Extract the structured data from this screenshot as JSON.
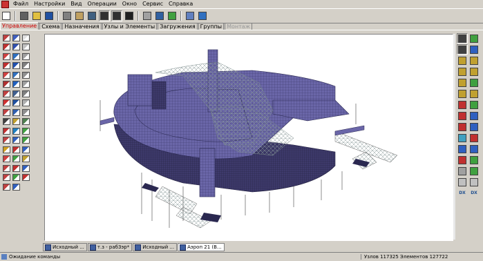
{
  "menu": {
    "items": [
      "Файл",
      "Настройки",
      "Вид",
      "Операции",
      "Окно",
      "Сервис",
      "Справка"
    ]
  },
  "toolbar": {
    "buttons": [
      {
        "icon": "new-file-icon",
        "color": "#ffffff"
      },
      {
        "icon": "print-icon",
        "color": "#606060"
      },
      {
        "icon": "open-folder-icon",
        "color": "#e0c040"
      },
      {
        "icon": "save-icon",
        "color": "#2050a0"
      },
      {
        "icon": "table-icon",
        "color": "#808080"
      },
      {
        "icon": "clipboard-icon",
        "color": "#c0a060"
      },
      {
        "icon": "filter-icon",
        "color": "#406080"
      },
      {
        "icon": "model-view-icon",
        "color": "#303030",
        "pressed": true
      },
      {
        "icon": "model-view-2-icon",
        "color": "#303030",
        "pressed": true
      },
      {
        "icon": "display-icon",
        "color": "#202020"
      },
      {
        "icon": "spring-icon",
        "color": "#a0a0a0"
      },
      {
        "icon": "calculator-icon",
        "color": "#3060a0"
      },
      {
        "icon": "results-icon",
        "color": "#40a040"
      },
      {
        "icon": "window-icon",
        "color": "#6080c0"
      },
      {
        "icon": "help-icon",
        "color": "#3070c0"
      }
    ]
  },
  "tabs": [
    {
      "label": "Управление",
      "state": "active"
    },
    {
      "label": "Схема",
      "state": "normal"
    },
    {
      "label": "Назначения",
      "state": "normal"
    },
    {
      "label": "Узлы и Элементы",
      "state": "normal"
    },
    {
      "label": "Загружения",
      "state": "normal"
    },
    {
      "label": "Группы",
      "state": "normal"
    },
    {
      "label": "Монтаж",
      "state": "disabled"
    }
  ],
  "left_panel": {
    "button_colors": [
      "#c04040",
      "#4060c0",
      "#e0e0e0",
      "#c03030",
      "#3050b0",
      "#c0c0c0",
      "#d04040",
      "#3070c0",
      "#a0a0a0",
      "#c03030",
      "#2050b0",
      "#808080",
      "#d04040",
      "#3070c0",
      "#909090",
      "#b03030",
      "#2060c0",
      "#a0a0a0",
      "#c04040",
      "#406090",
      "#808080",
      "#d03030",
      "#2050a0",
      "#b0b0b0",
      "#c04040",
      "#3060b0",
      "#909090",
      "#404040",
      "#c0a030",
      "#508050",
      "#c03030",
      "#2080c0",
      "#40a040",
      "#c04040",
      "#3060c0",
      "#40a040",
      "#d0a020",
      "#c03030",
      "#3060c0",
      "#d04040",
      "#40a040",
      "#c0a030",
      "#c04040",
      "#c03030",
      "#3060c0",
      "#c04040",
      "#40a040",
      "#c03030",
      "#c04040",
      "#3060c0"
    ]
  },
  "right_panel": {
    "buttons": [
      {
        "icon": "rotate-icon",
        "color": "#404040",
        "pressed": true
      },
      {
        "icon": "rotate-axis-icon",
        "color": "#40a040"
      },
      {
        "icon": "eye-icon",
        "color": "#404040",
        "pressed": true
      },
      {
        "icon": "pan-icon",
        "color": "#3060c0"
      },
      {
        "icon": "view-front-icon",
        "color": "#c0a030"
      },
      {
        "icon": "view-top-icon",
        "color": "#c0a030"
      },
      {
        "icon": "view-side-icon",
        "color": "#c0a030"
      },
      {
        "icon": "view-iso-icon",
        "color": "#c0a030"
      },
      {
        "icon": "view-xz-icon",
        "color": "#c0a030"
      },
      {
        "icon": "view-yz-icon",
        "color": "#40a040"
      },
      {
        "icon": "projection-icon",
        "color": "#c0a030"
      },
      {
        "icon": "perspective-icon",
        "color": "#c0a030"
      },
      {
        "icon": "fragment-icon",
        "color": "#c03030"
      },
      {
        "icon": "fragment-2-icon",
        "color": "#40a040"
      },
      {
        "icon": "cube-icon",
        "color": "#c03030"
      },
      {
        "icon": "cube-2-icon",
        "color": "#3060c0"
      },
      {
        "icon": "cube-3-icon",
        "color": "#c03030"
      },
      {
        "icon": "cube-4-icon",
        "color": "#3060c0"
      },
      {
        "icon": "cube-5-icon",
        "color": "#40a0c0"
      },
      {
        "icon": "cube-6-icon",
        "color": "#c03030"
      },
      {
        "icon": "zoom-icon",
        "color": "#3060c0"
      },
      {
        "icon": "zoom-out-icon",
        "color": "#3060c0"
      },
      {
        "icon": "zoom-in-icon",
        "color": "#c03030"
      },
      {
        "icon": "zoom-fit-icon",
        "color": "#40a040"
      },
      {
        "icon": "sphere-icon",
        "color": "#a0a0a0"
      },
      {
        "icon": "square-icon",
        "color": "#40a040"
      },
      {
        "icon": "frame-icon",
        "color": "#c0c0c0"
      },
      {
        "icon": "frame-2-icon",
        "color": "#c0c0c0"
      }
    ],
    "labels": [
      "DX",
      "DX"
    ]
  },
  "window_tabs": [
    {
      "label": "Исходный ..."
    },
    {
      "label": "т.з - раб3эр*"
    },
    {
      "label": "Исходный ..."
    },
    {
      "label": "Аэроп 21 (В..."
    }
  ],
  "status": {
    "left": "Ожидание команды",
    "right": "Узлов 117325 Элементов 127722"
  },
  "model": {
    "colors": {
      "slab": "#6a66a8",
      "slab_dark": "#46427a",
      "frame": "#8a9a9a",
      "lines": "#303030",
      "background": "#ffffff"
    }
  }
}
